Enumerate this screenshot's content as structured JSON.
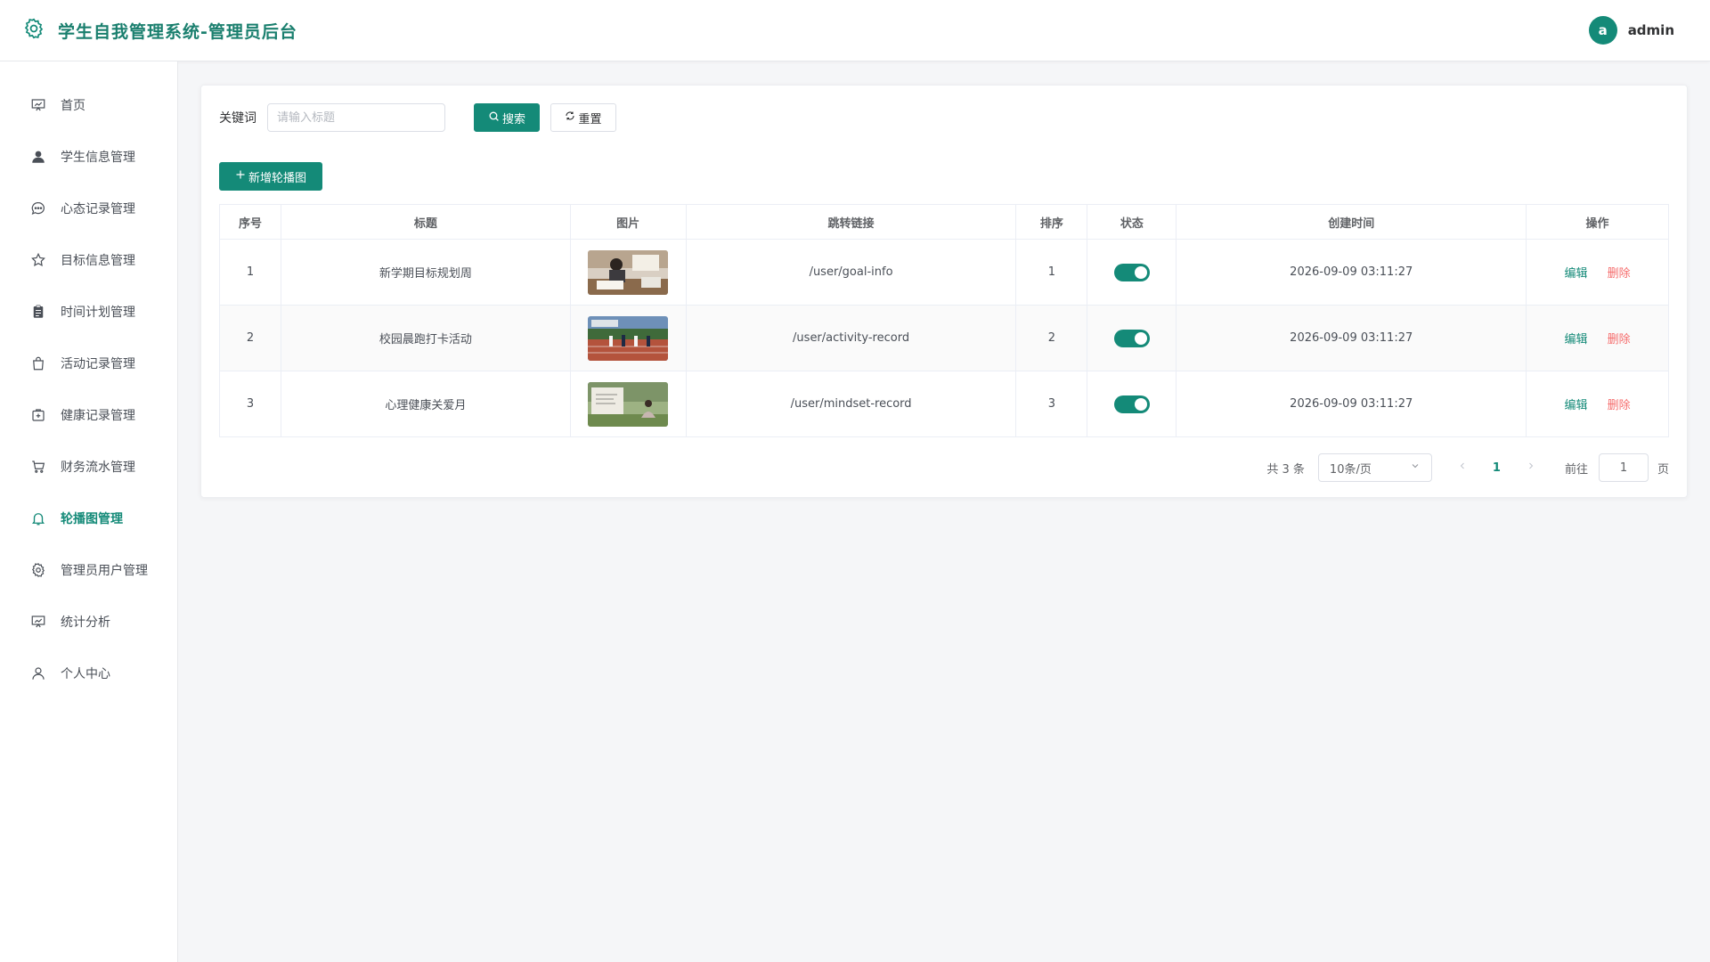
{
  "app": {
    "title": "学生自我管理系统-管理员后台",
    "user_initial": "a",
    "username": "admin",
    "accent": "#148a78",
    "danger": "#f56c6c"
  },
  "sidebar": {
    "items": [
      {
        "label": "首页",
        "icon": "dashboard-icon"
      },
      {
        "label": "学生信息管理",
        "icon": "user-icon"
      },
      {
        "label": "心态记录管理",
        "icon": "chat-bubble-icon"
      },
      {
        "label": "目标信息管理",
        "icon": "star-icon"
      },
      {
        "label": "时间计划管理",
        "icon": "clipboard-icon"
      },
      {
        "label": "活动记录管理",
        "icon": "shopping-bag-icon"
      },
      {
        "label": "健康记录管理",
        "icon": "first-aid-kit-icon"
      },
      {
        "label": "财务流水管理",
        "icon": "cart-icon"
      },
      {
        "label": "轮播图管理",
        "icon": "bell-icon",
        "active": true
      },
      {
        "label": "管理员用户管理",
        "icon": "gear-icon"
      },
      {
        "label": "统计分析",
        "icon": "presentation-chart-icon"
      },
      {
        "label": "个人中心",
        "icon": "person-outline-icon"
      }
    ]
  },
  "search": {
    "label": "关键词",
    "placeholder": "请输入标题",
    "search_button": "搜索",
    "reset_button": "重置"
  },
  "toolbar": {
    "add_button": "新增轮播图"
  },
  "table": {
    "columns": [
      "序号",
      "标题",
      "图片",
      "跳转链接",
      "排序",
      "状态",
      "创建时间",
      "操作"
    ],
    "rows": [
      {
        "index": "1",
        "title": "新学期目标规划周",
        "image": "study-desk-photo",
        "link": "/user/goal-info",
        "sort": "1",
        "enabled": true,
        "created": "2026-09-09 03:11:27"
      },
      {
        "index": "2",
        "title": "校园晨跑打卡活动",
        "image": "running-track-photo",
        "link": "/user/activity-record",
        "sort": "2",
        "enabled": true,
        "created": "2026-09-09 03:11:27"
      },
      {
        "index": "3",
        "title": "心理健康关爱月",
        "image": "meditation-park-photo",
        "link": "/user/mindset-record",
        "sort": "3",
        "enabled": true,
        "created": "2026-09-09 03:11:27"
      }
    ],
    "edit_label": "编辑",
    "delete_label": "删除"
  },
  "pagination": {
    "total_text": "共 3 条",
    "page_size": "10条/页",
    "current_page": "1",
    "goto_label": "前往",
    "goto_value": "1",
    "page_unit": "页"
  }
}
